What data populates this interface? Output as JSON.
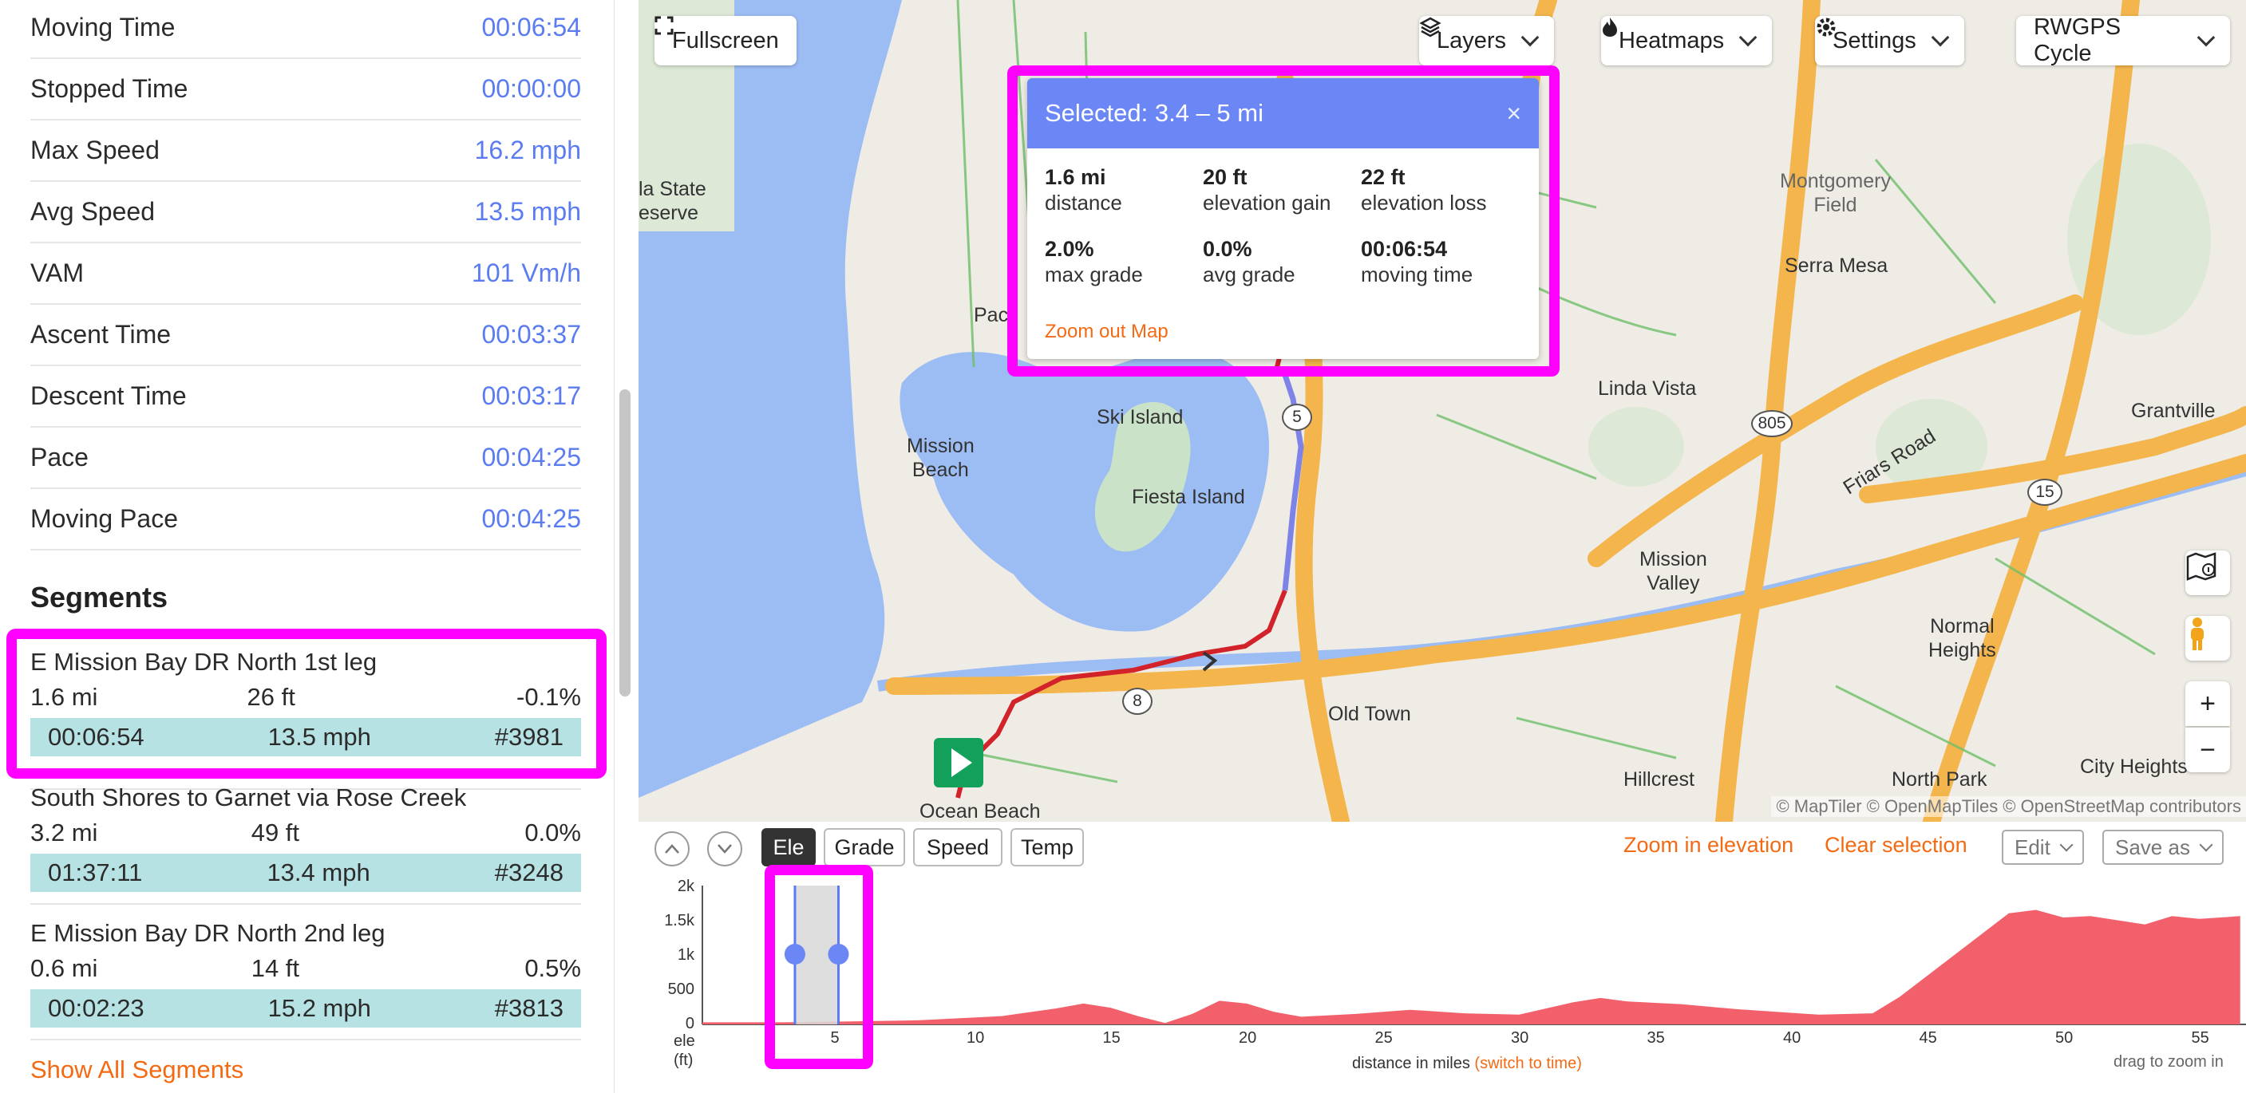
{
  "stats": [
    {
      "label": "Moving Time",
      "value": "00:06:54"
    },
    {
      "label": "Stopped Time",
      "value": "00:00:00"
    },
    {
      "label": "Max Speed",
      "value": "16.2 mph"
    },
    {
      "label": "Avg Speed",
      "value": "13.5 mph"
    },
    {
      "label": "VAM",
      "value": "101 Vm/h"
    },
    {
      "label": "Ascent Time",
      "value": "00:03:37"
    },
    {
      "label": "Descent Time",
      "value": "00:03:17"
    },
    {
      "label": "Pace",
      "value": "00:04:25"
    },
    {
      "label": "Moving Pace",
      "value": "00:04:25"
    }
  ],
  "segments_heading": "Segments",
  "segments": [
    {
      "name": "E Mission Bay DR North 1st leg",
      "distance": "1.6 mi",
      "elevation": "26 ft",
      "grade": "-0.1%",
      "time": "00:06:54",
      "speed": "13.5 mph",
      "rank": "#3981"
    },
    {
      "name": "South Shores to Garnet via Rose Creek",
      "distance": "3.2 mi",
      "elevation": "49 ft",
      "grade": "0.0%",
      "time": "01:37:11",
      "speed": "13.4 mph",
      "rank": "#3248"
    },
    {
      "name": "E Mission Bay DR North 2nd leg",
      "distance": "0.6 mi",
      "elevation": "14 ft",
      "grade": "0.5%",
      "time": "00:02:23",
      "speed": "15.2 mph",
      "rank": "#3813"
    }
  ],
  "show_all_segments": "Show All Segments",
  "map": {
    "fullscreen": "Fullscreen",
    "layers": "Layers",
    "heatmaps": "Heatmaps",
    "settings": "Settings",
    "style": "RWGPS Cycle",
    "attribution": "© MapTiler © OpenMapTiles © OpenStreetMap contributors",
    "labels": {
      "la_state": "la State\neserve",
      "montgomery": "Montgomery\nField",
      "serra_mesa": "Serra Mesa",
      "paci": "Paci",
      "linda_vista": "Linda Vista",
      "grantville": "Grantville",
      "ski_island": "Ski Island",
      "mission_beach": "Mission\nBeach",
      "fiesta_island": "Fiesta Island",
      "friars_road": "Friars Road",
      "mission_valley": "Mission\nValley",
      "normal_heights": "Normal\nHeights",
      "old_town": "Old Town",
      "hillcrest": "Hillcrest",
      "north_park": "North Park",
      "city_heights": "City Heights",
      "ocean_beach": "Ocean Beach"
    },
    "shields": {
      "i5": "5",
      "i8": "8",
      "r805": "805",
      "r15": "15"
    },
    "icons": {
      "map_layers": "map-legend-icon",
      "street_view": "pegman-icon",
      "zoom_in": "+",
      "zoom_out": "−"
    }
  },
  "popup": {
    "title": "Selected: 3.4 – 5 mi",
    "close": "×",
    "items": [
      {
        "value": "1.6 mi",
        "label": "distance"
      },
      {
        "value": "20 ft",
        "label": "elevation gain"
      },
      {
        "value": "22 ft",
        "label": "elevation loss"
      },
      {
        "value": "2.0%",
        "label": "max grade"
      },
      {
        "value": "0.0%",
        "label": "avg grade"
      },
      {
        "value": "00:06:54",
        "label": "moving time"
      }
    ],
    "zoom_out": "Zoom out Map"
  },
  "elevation": {
    "tabs": [
      "Ele",
      "Grade",
      "Speed",
      "Temp"
    ],
    "active_tab": "Ele",
    "zoom_in": "Zoom in elevation",
    "clear": "Clear selection",
    "edit": "Edit",
    "save_as": "Save as",
    "y_ticks": [
      "2k",
      "1.5k",
      "1k",
      "500",
      "0"
    ],
    "y_unit_1": "ele",
    "y_unit_2": "(ft)",
    "x_ticks": [
      "5",
      "10",
      "15",
      "20",
      "25",
      "30",
      "35",
      "40",
      "45",
      "50",
      "55"
    ],
    "x_label": "distance in miles",
    "switch_time": "(switch to time)",
    "drag_hint": "drag to zoom in",
    "selection_mi": [
      3.4,
      5.0
    ],
    "profile_color": "#f2616b"
  }
}
